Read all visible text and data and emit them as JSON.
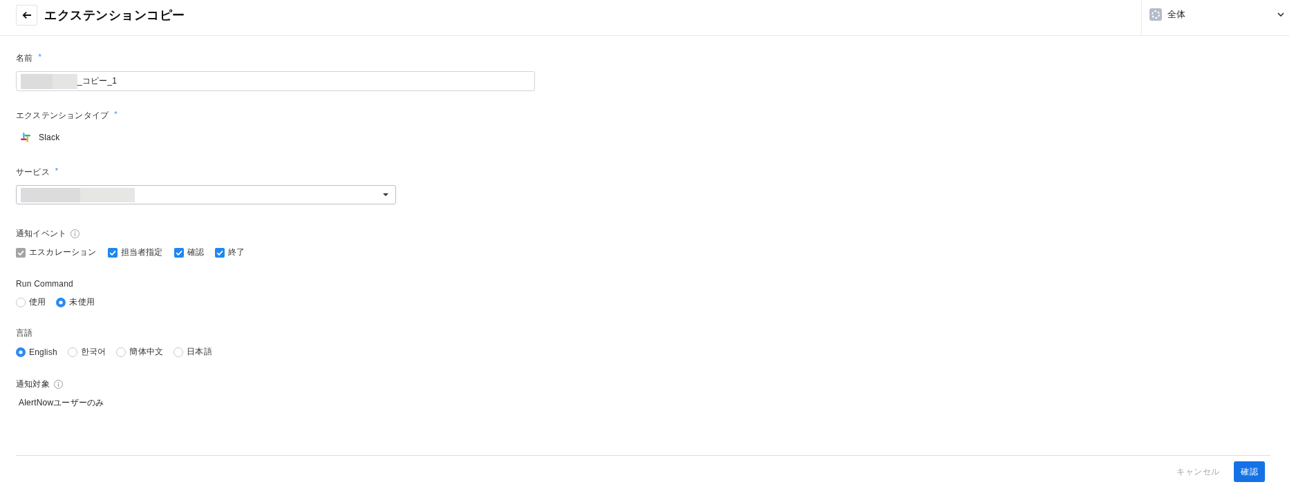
{
  "header": {
    "title": "エクステンションコピー",
    "scope": {
      "label": "全体"
    }
  },
  "form": {
    "fields": [
      {
        "kind": "input",
        "label": "名前",
        "required_mark": "*",
        "value": "_コピー_1",
        "redacted": true
      },
      {
        "kind": "type",
        "label": "エクステンションタイプ",
        "required_mark": "*",
        "value": "Slack"
      },
      {
        "kind": "select",
        "label": "サービス",
        "required_mark": "*",
        "redacted": true
      },
      {
        "kind": "checkboxes",
        "label": "通知イベント",
        "info": true,
        "options": [
          {
            "label": "エスカレーション",
            "checked": true,
            "disabled": true
          },
          {
            "label": "担当者指定",
            "checked": true,
            "disabled": false
          },
          {
            "label": "確認",
            "checked": true,
            "disabled": false
          },
          {
            "label": "終了",
            "checked": true,
            "disabled": false
          }
        ]
      },
      {
        "kind": "radios",
        "label": "Run Command",
        "options": [
          {
            "label": "使用",
            "selected": false
          },
          {
            "label": "未使用",
            "selected": true
          }
        ]
      },
      {
        "kind": "radios",
        "label": "言語",
        "options": [
          {
            "label": "English",
            "selected": true
          },
          {
            "label": "한국어",
            "selected": false
          },
          {
            "label": "簡体中文",
            "selected": false
          },
          {
            "label": "日本語",
            "selected": false
          }
        ]
      },
      {
        "kind": "text",
        "label": "通知対象",
        "info": true,
        "value": "AlertNowユーザーのみ"
      }
    ]
  },
  "footer": {
    "buttons": [
      {
        "kind": "secondary",
        "label": "キャンセル"
      },
      {
        "kind": "primary",
        "label": "確認"
      }
    ]
  }
}
